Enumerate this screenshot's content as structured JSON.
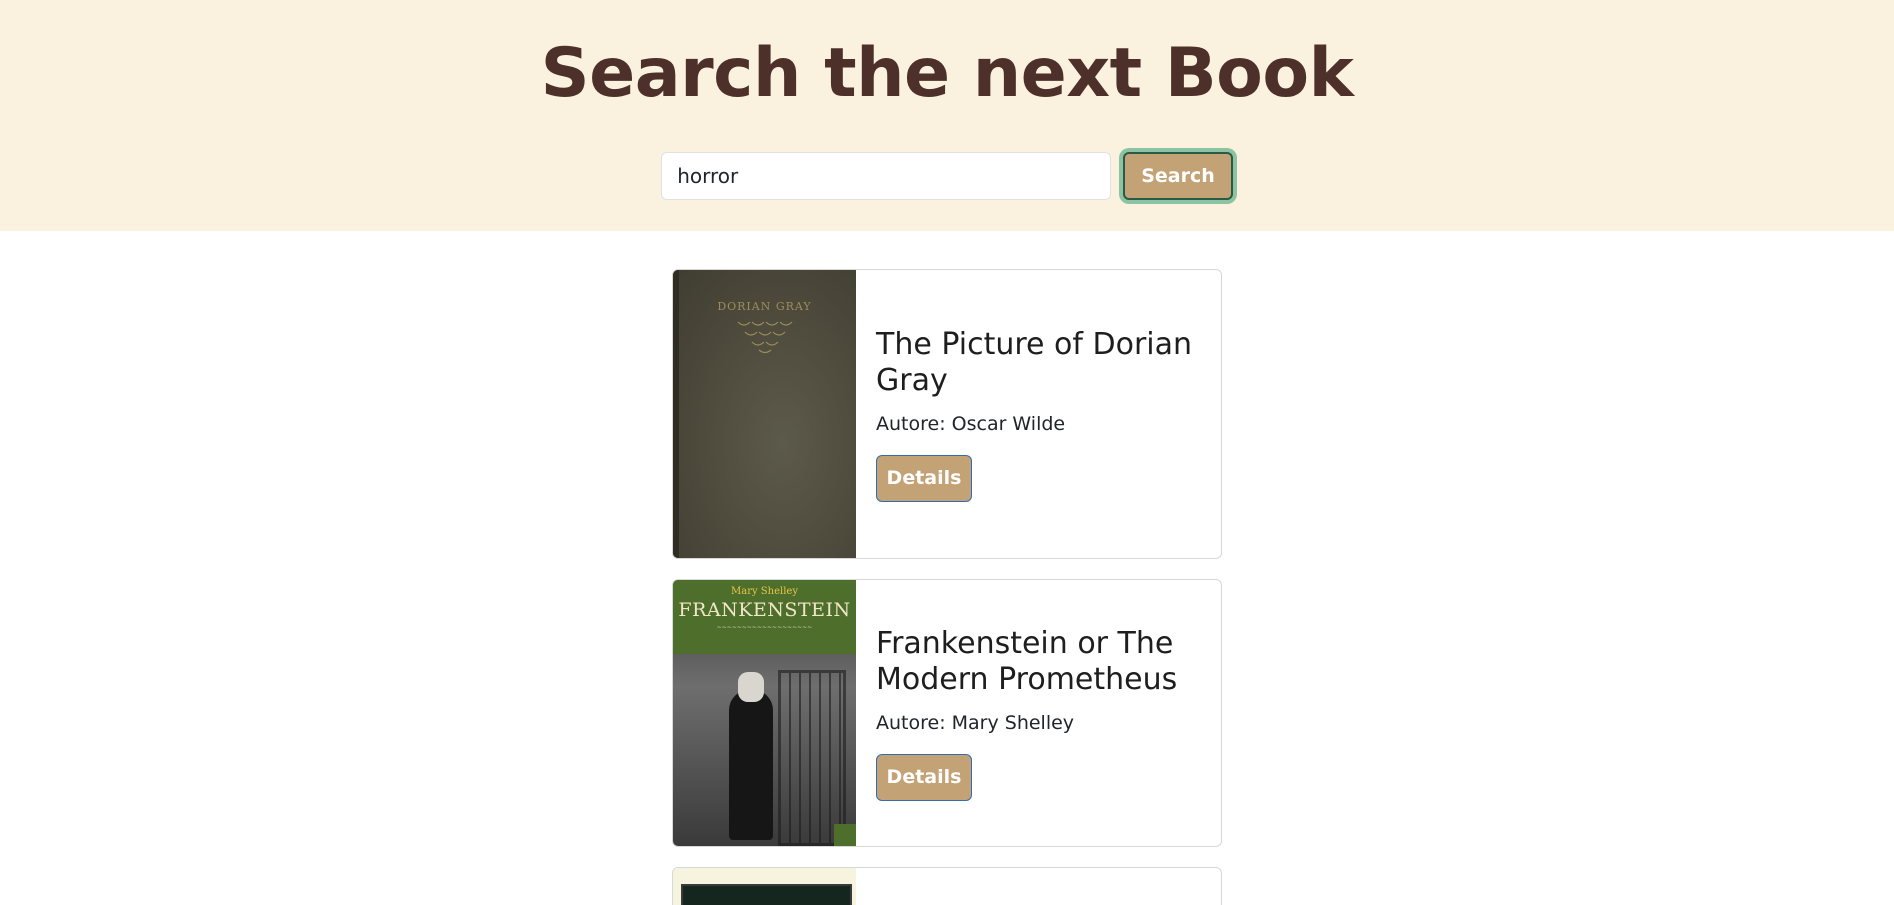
{
  "header": {
    "title": "Search the next Book"
  },
  "search": {
    "value": "horror",
    "button_label": "Search"
  },
  "books": [
    {
      "title": "The Picture of Dorian Gray",
      "author": "Autore: Oscar Wilde",
      "details_label": "Details",
      "cover_text": "DORIAN GRAY"
    },
    {
      "title": "Frankenstein or The Modern Prometheus",
      "author": "Autore: Mary Shelley",
      "details_label": "Details",
      "cover_author": "Mary Shelley",
      "cover_title": "FRANKENSTEIN"
    }
  ],
  "colors": {
    "header_bg": "#faf1de",
    "title": "#4e302b",
    "button_bg": "#c3a275"
  }
}
